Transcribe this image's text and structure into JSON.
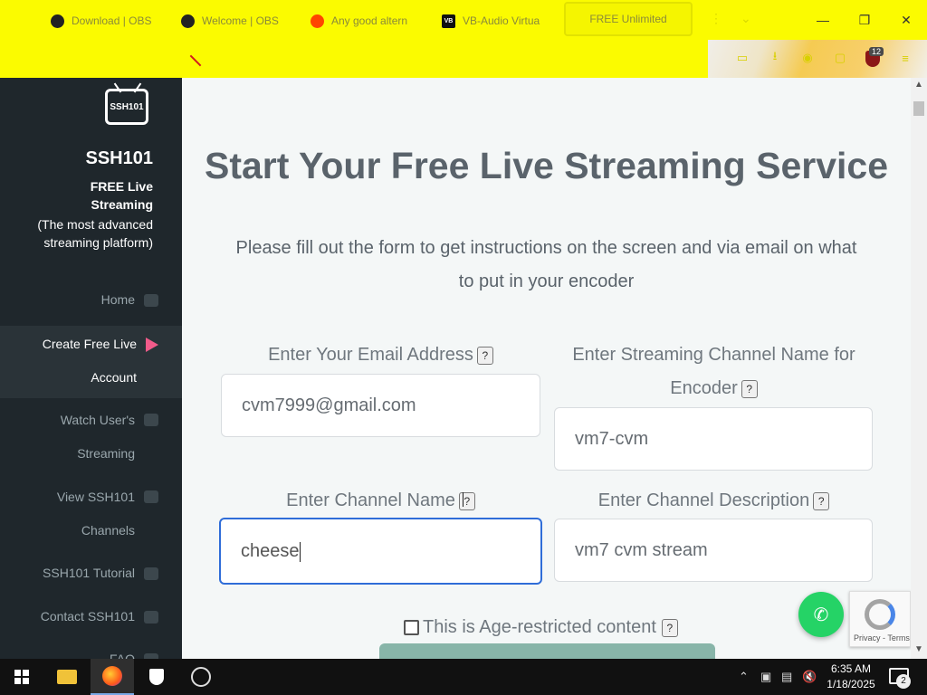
{
  "browser": {
    "tabs": [
      {
        "label": "Download | OBS",
        "icon": "obs-icon"
      },
      {
        "label": "Welcome | OBS",
        "icon": "obs-icon"
      },
      {
        "label": "Any good altern",
        "icon": "reddit-icon"
      },
      {
        "label": "VB-Audio Virtua",
        "icon": "vb-audio-icon"
      },
      {
        "label": "FREE Unlimited",
        "icon": "none"
      }
    ],
    "extension_badge": "12",
    "theme_color": "#fbfb00"
  },
  "sidebar": {
    "logo_text": "SSH101",
    "brand": "SSH101",
    "tagline_bold": "FREE Live Streaming",
    "tagline": "(The most advanced streaming platform)",
    "items": [
      {
        "label": "Home",
        "icon": "home-icon"
      },
      {
        "label": "Create Free Live Account",
        "icon": "play-icon"
      },
      {
        "label": "Watch User's Streaming",
        "icon": "eye-icon"
      },
      {
        "label": "View SSH101 Channels",
        "icon": "monitor-icon"
      },
      {
        "label": "SSH101 Tutorial",
        "icon": "question-icon"
      },
      {
        "label": "Contact SSH101",
        "icon": "user-icon"
      },
      {
        "label": "FAQ",
        "icon": "question-circle-icon"
      }
    ],
    "accent": "#f25b8a"
  },
  "main": {
    "heading": "Start Your Free Live Streaming Service",
    "subtext": "Please fill out the form to get instructions on the screen and via email on what to put in your encoder",
    "help_mark": "?",
    "form": {
      "email_label": "Enter Your Email Address",
      "email_value": "cvm7999@gmail.com",
      "stream_label": "Enter Streaming Channel Name for Encoder",
      "stream_value": "vm7-cvm",
      "channel_label": "Enter Channel Name",
      "channel_value": "cheese",
      "desc_label": "Enter Channel Description",
      "desc_value": "vm7 cvm stream",
      "age_label": "This is Age-restricted content"
    }
  },
  "recaptcha": {
    "text": "Privacy - Terms"
  },
  "taskbar": {
    "time": "6:35 AM",
    "date": "1/18/2025",
    "notifications": "2"
  }
}
